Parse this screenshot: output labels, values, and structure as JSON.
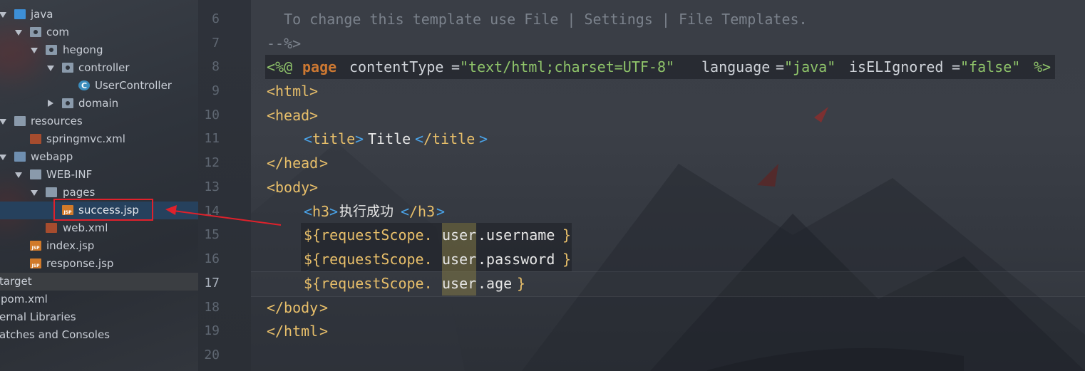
{
  "project_tree": {
    "items": [
      {
        "label": "java"
      },
      {
        "label": "com"
      },
      {
        "label": "hegong"
      },
      {
        "label": "controller"
      },
      {
        "label": "UserController"
      },
      {
        "label": "domain"
      },
      {
        "label": "resources"
      },
      {
        "label": "springmvc.xml"
      },
      {
        "label": "webapp"
      },
      {
        "label": "WEB-INF"
      },
      {
        "label": "pages"
      },
      {
        "label": "success.jsp"
      },
      {
        "label": "web.xml"
      },
      {
        "label": "index.jsp"
      },
      {
        "label": "response.jsp"
      },
      {
        "label": "target"
      },
      {
        "label": "pom.xml"
      },
      {
        "label": "ernal Libraries"
      },
      {
        "label": "atches and Consoles"
      }
    ],
    "class_icon_letter": "C"
  },
  "editor": {
    "line_numbers": [
      "6",
      "7",
      "8",
      "9",
      "10",
      "11",
      "12",
      "13",
      "14",
      "15",
      "16",
      "17",
      "18",
      "19",
      "20"
    ],
    "current_line": "17",
    "code": {
      "l6_comment": "  To change this template use File | Settings | File Templates.",
      "l7_comment": "--%>",
      "l8_open": "<%@",
      "l8_page": "page",
      "l8_attr1": "contentType",
      "l8_eq1": "=",
      "l8_val1": "\"text/html;charset=UTF-8\"",
      "l8_attr2": "language",
      "l8_eq2": "=",
      "l8_val2": "\"java\"",
      "l8_attr3": "isELIgnored",
      "l8_eq3": "=",
      "l8_val3": "\"false\"",
      "l8_close": "%>",
      "html_open": "html",
      "head_open": "head",
      "title_tag": "title",
      "title_text": "Title",
      "head_close": "/head",
      "body_open": "body",
      "h3_tag": "h3",
      "h3_text": "执行成功",
      "h3_close": "/h3",
      "el_prefix": "${requestScope.",
      "el_user": "user",
      "el1_prop": ".username",
      "el2_prop": ".password",
      "el3_prop": ".age",
      "el_close": "}",
      "body_close": "/body",
      "html_close": "/html",
      "lt": "<",
      "gt": ">"
    }
  },
  "colors": {
    "selection_box": "#e0212b",
    "arrow": "#e0212b",
    "tag": "#e8bf6a",
    "string": "#8fc46a",
    "keyword": "#cc7832"
  }
}
